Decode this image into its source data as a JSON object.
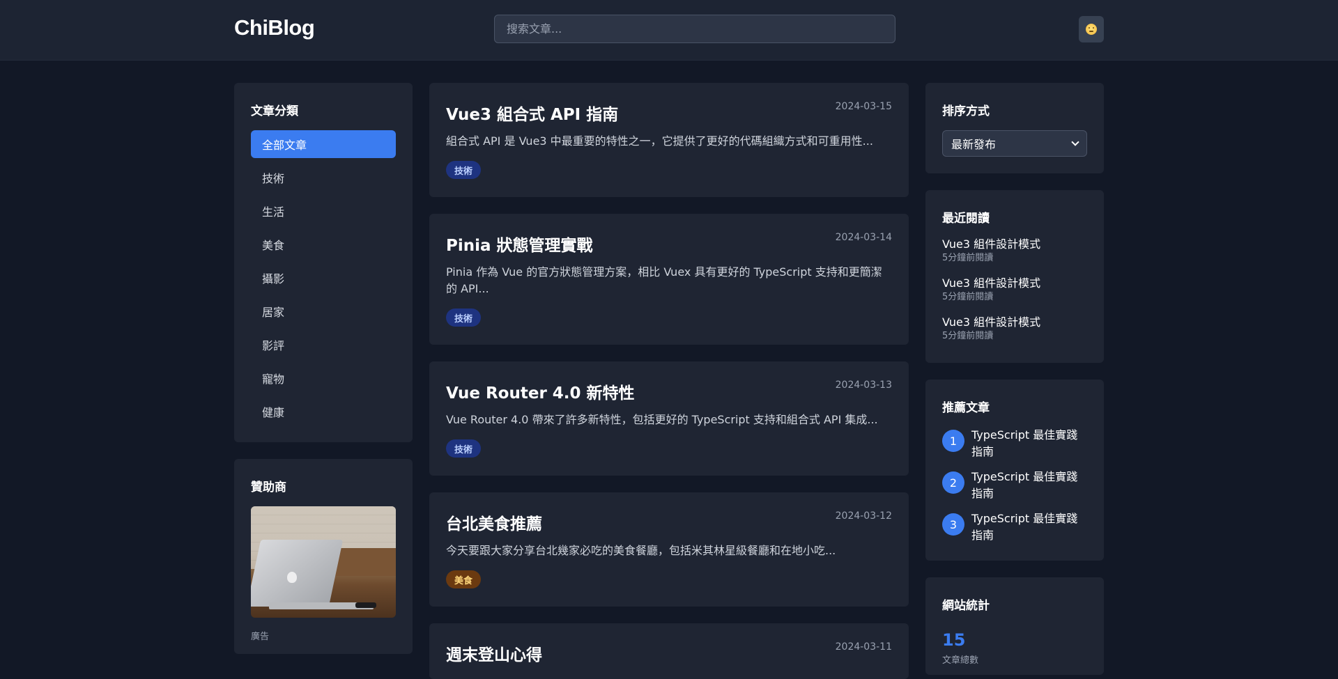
{
  "header": {
    "logo": "ChiBlog",
    "search_placeholder": "搜索文章...",
    "theme_icon": "emoji-face-icon"
  },
  "categories": {
    "title": "文章分類",
    "items": [
      "全部文章",
      "技術",
      "生活",
      "美食",
      "攝影",
      "居家",
      "影評",
      "寵物",
      "健康"
    ],
    "active_index": 0
  },
  "sponsor": {
    "title": "贊助商",
    "label": "廣告"
  },
  "articles": [
    {
      "title": "Vue3 組合式 API 指南",
      "date": "2024-03-15",
      "excerpt": "組合式 API 是 Vue3 中最重要的特性之一，它提供了更好的代碼組織方式和可重用性...",
      "tag": "技術"
    },
    {
      "title": "Pinia 狀態管理實戰",
      "date": "2024-03-14",
      "excerpt": "Pinia 作為 Vue 的官方狀態管理方案，相比 Vuex 具有更好的 TypeScript 支持和更簡潔的 API...",
      "tag": "技術"
    },
    {
      "title": "Vue Router 4.0 新特性",
      "date": "2024-03-13",
      "excerpt": "Vue Router 4.0 帶來了許多新特性，包括更好的 TypeScript 支持和組合式 API 集成...",
      "tag": "技術"
    },
    {
      "title": "台北美食推薦",
      "date": "2024-03-12",
      "excerpt": "今天要跟大家分享台北幾家必吃的美食餐廳，包括米其林星級餐廳和在地小吃...",
      "tag": "美食"
    },
    {
      "title": "週末登山心得",
      "date": "2024-03-11",
      "excerpt": "",
      "tag": ""
    }
  ],
  "sort": {
    "title": "排序方式",
    "selected": "最新發布"
  },
  "recent": {
    "title": "最近閱讀",
    "items": [
      {
        "title": "Vue3 組件設計模式",
        "time": "5分鐘前閱讀"
      },
      {
        "title": "Vue3 組件設計模式",
        "time": "5分鐘前閱讀"
      },
      {
        "title": "Vue3 組件設計模式",
        "time": "5分鐘前閱讀"
      }
    ]
  },
  "recommended": {
    "title": "推薦文章",
    "items": [
      {
        "num": "1",
        "title": "TypeScript 最佳實踐指南"
      },
      {
        "num": "2",
        "title": "TypeScript 最佳實踐指南"
      },
      {
        "num": "3",
        "title": "TypeScript 最佳實踐指南"
      }
    ]
  },
  "stats": {
    "title": "網站統計",
    "value": "15",
    "label": "文章總數"
  },
  "colors": {
    "accent": "#3b7cf0",
    "background": "#121826",
    "card": "#1f2533",
    "tag_tech": "#1e3380",
    "tag_food": "#6b3a10"
  }
}
